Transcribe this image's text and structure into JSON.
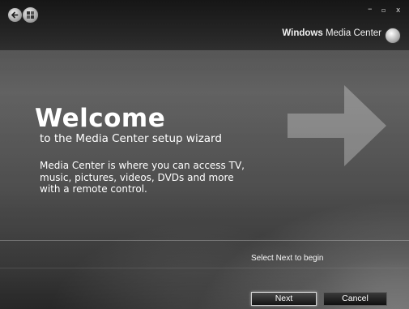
{
  "titlebar": {
    "back_icon": "back-arrow-icon",
    "start_icon": "windows-start-orb-icon",
    "minimize_label": "–",
    "maximize_label": "▫",
    "close_label": "x"
  },
  "brand": {
    "bold": "Windows",
    "rest": " Media Center",
    "icon": "windows-media-center-orb-icon"
  },
  "main": {
    "heading": "Welcome",
    "subtitle": "to the Media Center setup wizard",
    "description": "Media Center is where you can access TV, music, pictures, videos, DVDs and more with a remote control.",
    "decoration_icon": "right-arrow-icon"
  },
  "footer": {
    "hint": "Select Next to begin",
    "next_label": "Next",
    "cancel_label": "Cancel"
  }
}
